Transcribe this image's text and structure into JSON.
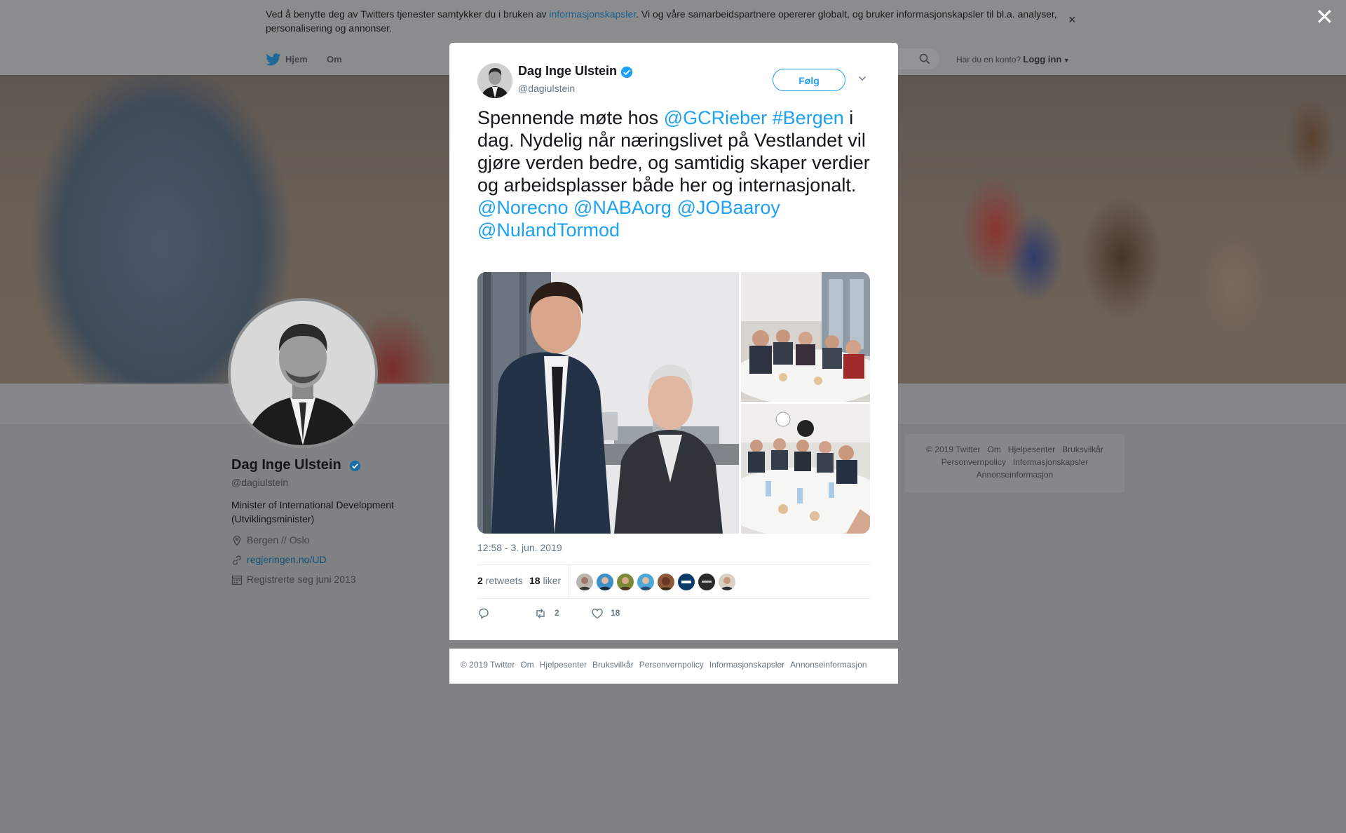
{
  "cookie_bar": {
    "text_before": "Ved å benytte deg av Twitters tjenester samtykker du i bruken av ",
    "link": "informasjonskapsler",
    "text_after": ". Vi og våre samarbeidspartnere opererer globalt, og bruker informasjonskapsler til bl.a. analyser, personalisering og annonser.",
    "close": "×"
  },
  "page_close": "✕",
  "nav": {
    "home": "Hjem",
    "about": "Om",
    "account_prompt": "Har du en konto?",
    "login": "Logg inn"
  },
  "profile": {
    "name": "Dag Inge Ulstein",
    "handle": "@dagiulstein",
    "bio": "Minister of International Development (Utviklingsminister)",
    "location": "Bergen // Oslo",
    "link": "regjeringen.no/UD",
    "joined": "Registrerte seg juni 2013"
  },
  "side_footer": {
    "items": [
      "© 2019 Twitter",
      "Om",
      "Hjelpesenter",
      "Bruksvilkår",
      "Personvernpolicy",
      "Informasjonskapsler",
      "Annonseinformasjon"
    ]
  },
  "tweet": {
    "author_name": "Dag Inge Ulstein",
    "author_handle": "@dagiulstein",
    "follow_label": "Følg",
    "text": {
      "p1": "Spennende møte hos ",
      "m1": "@GCRieber",
      "h1": "#Bergen",
      "p2": " i dag. Nydelig når næringslivet på Vestlandet vil gjøre verden bedre,  og samtidig skaper verdier og arbeidsplasser både her og internasjonalt.",
      "m2": "@Norecno",
      "m3": "@NABAorg",
      "m4": "@JOBaaroy",
      "m5": "@NulandTormod"
    },
    "timestamp": "12:58 - 3. jun. 2019",
    "retweets": "2",
    "retweets_label": "retweets",
    "likes": "18",
    "likes_label": "liker",
    "reply_count": "",
    "retweet_count": "2",
    "like_count": "18"
  },
  "modal_footer": {
    "items": [
      "© 2019 Twitter",
      "Om",
      "Hjelpesenter",
      "Bruksvilkår",
      "Personvernpolicy",
      "Informasjonskapsler",
      "Annonseinformasjon"
    ]
  },
  "colors": {
    "accent": "#1da1f2",
    "overlay": "#7f8183",
    "verified": "#1da1f2"
  },
  "icons": [
    "twitter-bird-icon",
    "search-icon",
    "verified-icon",
    "chevron-down-icon",
    "location-icon",
    "link-icon",
    "calendar-icon",
    "reply-icon",
    "retweet-icon",
    "like-icon",
    "close-icon"
  ]
}
